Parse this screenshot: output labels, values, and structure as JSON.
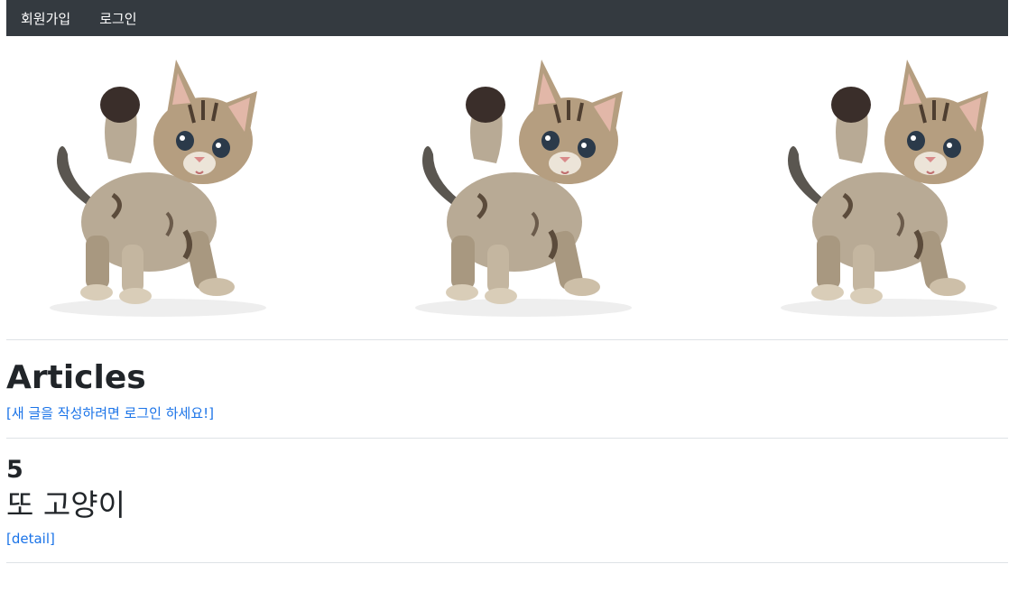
{
  "nav": {
    "signup_label": "회원가입",
    "login_label": "로그인",
    "background": "#343a40"
  },
  "hero": {
    "images": [
      {
        "alt": "kitten-icon"
      },
      {
        "alt": "kitten-icon"
      },
      {
        "alt": "kitten-icon"
      }
    ]
  },
  "page": {
    "heading": "Articles",
    "login_prompt": "[새 글을 작성하려면 로그인 하세요!]"
  },
  "articles": [
    {
      "id": "5",
      "title": "또 고양이",
      "detail_label": "[detail]"
    }
  ],
  "colors": {
    "link": "#1a73e8",
    "text": "#212529",
    "divider": "#dee2e6"
  }
}
